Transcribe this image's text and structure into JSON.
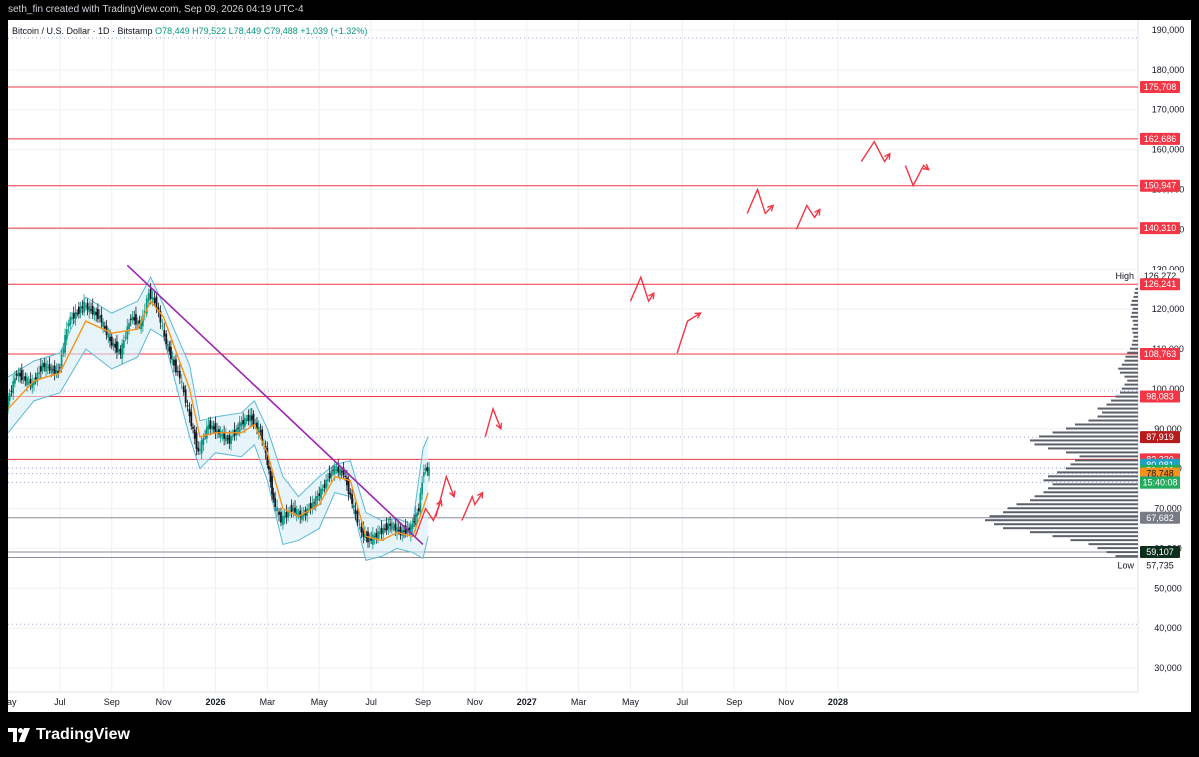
{
  "header": {
    "created_text": "seth_fin created with TradingView.com, Sep 09, 2026 04:19 UTC-4"
  },
  "legend": {
    "symbol": "Bitcoin / U.S. Dollar · 1D · Bitstamp",
    "open": "O78,449",
    "high": "H79,522",
    "low": "L78,449",
    "close": "C79,488",
    "change": "+1,039 (+1.32%)"
  },
  "footer": {
    "brand": "TradingView"
  },
  "colors": {
    "up": "#089981",
    "down": "#131722",
    "bb": "#5bb8d6",
    "bb_fill": "#d7eef6",
    "ma": "#f7931a",
    "trendline": "#9c27b0",
    "resistance": "#f23645",
    "grid": "#eef0f3",
    "axis_text": "#131722"
  },
  "chart_data": {
    "type": "line",
    "title": "Bitcoin / U.S. Dollar · 1D · Bitstamp",
    "y_axis": {
      "ticks": [
        30000,
        40000,
        50000,
        60000,
        70000,
        80000,
        90000,
        100000,
        110000,
        120000,
        130000,
        140000,
        150000,
        160000,
        170000,
        180000,
        190000
      ],
      "tick_labels": [
        "30,000",
        "40,000",
        "50,000",
        "60,000",
        "70,000",
        "80,000",
        "90,000",
        "100,000",
        "110,000",
        "120,000",
        "130,000",
        "140,000",
        "150,000",
        "160,000",
        "170,000",
        "180,000",
        "190,000"
      ],
      "range": [
        24000,
        192500
      ]
    },
    "x_axis": {
      "labels": [
        "May",
        "Jul",
        "Sep",
        "Nov",
        "2026",
        "Mar",
        "May",
        "Jul",
        "Sep",
        "Nov",
        "2027",
        "Mar",
        "May",
        "Jul",
        "Sep",
        "Nov",
        "2028"
      ],
      "bold": [
        false,
        false,
        false,
        false,
        true,
        false,
        false,
        false,
        false,
        false,
        true,
        false,
        false,
        false,
        false,
        false,
        true
      ],
      "index_range": [
        0,
        19
      ]
    },
    "price_path": [
      [
        0.0,
        96000
      ],
      [
        0.2,
        104000
      ],
      [
        0.5,
        101000
      ],
      [
        0.7,
        106000
      ],
      [
        1.0,
        104000
      ],
      [
        1.2,
        117000
      ],
      [
        1.5,
        121000
      ],
      [
        1.8,
        118000
      ],
      [
        2.0,
        112000
      ],
      [
        2.2,
        109000
      ],
      [
        2.4,
        118000
      ],
      [
        2.6,
        116000
      ],
      [
        2.75,
        124000
      ],
      [
        2.9,
        121000
      ],
      [
        3.05,
        113000
      ],
      [
        3.2,
        107000
      ],
      [
        3.35,
        103000
      ],
      [
        3.5,
        95000
      ],
      [
        3.7,
        84000
      ],
      [
        3.9,
        91000
      ],
      [
        4.1,
        89000
      ],
      [
        4.3,
        87000
      ],
      [
        4.5,
        91000
      ],
      [
        4.7,
        93000
      ],
      [
        4.9,
        89000
      ],
      [
        5.0,
        84000
      ],
      [
        5.15,
        72000
      ],
      [
        5.3,
        67000
      ],
      [
        5.5,
        70000
      ],
      [
        5.7,
        68000
      ],
      [
        5.9,
        71000
      ],
      [
        6.1,
        75000
      ],
      [
        6.3,
        80000
      ],
      [
        6.5,
        79000
      ],
      [
        6.7,
        70000
      ],
      [
        6.85,
        64000
      ],
      [
        7.0,
        62000
      ],
      [
        7.2,
        64000
      ],
      [
        7.4,
        66000
      ],
      [
        7.6,
        64000
      ],
      [
        7.8,
        65000
      ],
      [
        7.95,
        70000
      ],
      [
        8.05,
        80000
      ],
      [
        8.15,
        79488
      ]
    ],
    "bollinger": {
      "upper": [
        [
          0,
          103000
        ],
        [
          0.5,
          107000
        ],
        [
          1,
          109000
        ],
        [
          1.5,
          123000
        ],
        [
          2,
          119000
        ],
        [
          2.5,
          122000
        ],
        [
          2.75,
          128000
        ],
        [
          3,
          121000
        ],
        [
          3.5,
          106000
        ],
        [
          3.7,
          92000
        ],
        [
          4,
          93000
        ],
        [
          4.5,
          94000
        ],
        [
          4.75,
          97000
        ],
        [
          5,
          90000
        ],
        [
          5.3,
          78000
        ],
        [
          5.6,
          73000
        ],
        [
          6,
          78000
        ],
        [
          6.3,
          81000
        ],
        [
          6.6,
          82000
        ],
        [
          6.9,
          69000
        ],
        [
          7.2,
          67000
        ],
        [
          7.5,
          67500
        ],
        [
          7.8,
          66000
        ],
        [
          8.0,
          85000
        ],
        [
          8.1,
          88000
        ]
      ],
      "lower": [
        [
          0,
          89000
        ],
        [
          0.5,
          97000
        ],
        [
          1,
          99000
        ],
        [
          1.5,
          110000
        ],
        [
          2,
          105000
        ],
        [
          2.5,
          108000
        ],
        [
          2.75,
          115000
        ],
        [
          3,
          113000
        ],
        [
          3.5,
          88000
        ],
        [
          3.7,
          80000
        ],
        [
          4,
          84000
        ],
        [
          4.5,
          83000
        ],
        [
          4.75,
          86000
        ],
        [
          5,
          77000
        ],
        [
          5.3,
          61000
        ],
        [
          5.6,
          62000
        ],
        [
          6,
          65000
        ],
        [
          6.3,
          74000
        ],
        [
          6.6,
          73000
        ],
        [
          6.9,
          57000
        ],
        [
          7.2,
          58000
        ],
        [
          7.5,
          60000
        ],
        [
          7.8,
          59000
        ],
        [
          8.0,
          57500
        ],
        [
          8.1,
          63000
        ]
      ]
    },
    "moving_average": [
      [
        0,
        95000
      ],
      [
        0.5,
        102000
      ],
      [
        1,
        104000
      ],
      [
        1.5,
        117000
      ],
      [
        2,
        114000
      ],
      [
        2.5,
        115000
      ],
      [
        2.75,
        122000
      ],
      [
        3,
        118000
      ],
      [
        3.5,
        100000
      ],
      [
        3.7,
        88000
      ],
      [
        4,
        89000
      ],
      [
        4.5,
        89000
      ],
      [
        4.75,
        91000
      ],
      [
        5,
        84000
      ],
      [
        5.3,
        70000
      ],
      [
        5.6,
        68000
      ],
      [
        6,
        71000
      ],
      [
        6.3,
        78000
      ],
      [
        6.6,
        77000
      ],
      [
        6.9,
        63000
      ],
      [
        7.2,
        62000
      ],
      [
        7.5,
        64000
      ],
      [
        7.8,
        63000
      ],
      [
        8.0,
        70000
      ],
      [
        8.1,
        74000
      ]
    ],
    "trendline": [
      [
        2.3,
        131000
      ],
      [
        8.0,
        61000
      ]
    ],
    "resistance_levels": [
      175708,
      162686,
      150947,
      140310,
      126241,
      108763,
      98083,
      82320
    ],
    "gray_levels": [
      67682,
      57735,
      59107
    ],
    "dotted_levels": [
      188000,
      99500,
      87919,
      80200,
      78748,
      76577,
      41000
    ],
    "projection_zigzags": [
      [
        [
          7.85,
          63000
        ],
        [
          8.05,
          70000
        ],
        [
          8.2,
          67000
        ],
        [
          8.35,
          72000
        ]
      ],
      [
        [
          8.25,
          68000
        ],
        [
          8.45,
          78000
        ],
        [
          8.6,
          73000
        ]
      ],
      [
        [
          8.75,
          67000
        ],
        [
          8.95,
          73000
        ],
        [
          9.0,
          71000
        ],
        [
          9.15,
          74000
        ]
      ],
      [
        [
          9.2,
          88000
        ],
        [
          9.35,
          95000
        ],
        [
          9.5,
          90000
        ]
      ],
      [
        [
          12.0,
          122000
        ],
        [
          12.2,
          128000
        ],
        [
          12.35,
          122000
        ],
        [
          12.45,
          124000
        ]
      ],
      [
        [
          12.9,
          109000
        ],
        [
          13.1,
          117000
        ],
        [
          13.35,
          119000
        ]
      ],
      [
        [
          14.25,
          144000
        ],
        [
          14.45,
          150000
        ],
        [
          14.6,
          144000
        ],
        [
          14.75,
          146000
        ]
      ],
      [
        [
          15.2,
          140000
        ],
        [
          15.4,
          146000
        ],
        [
          15.55,
          143000
        ],
        [
          15.65,
          145000
        ]
      ],
      [
        [
          16.45,
          157000
        ],
        [
          16.7,
          162000
        ],
        [
          16.9,
          157000
        ],
        [
          17.0,
          159000
        ]
      ],
      [
        [
          17.3,
          156000
        ],
        [
          17.45,
          151000
        ],
        [
          17.65,
          156000
        ],
        [
          17.75,
          155000
        ]
      ]
    ],
    "volume_profile": [
      [
        58000,
        25
      ],
      [
        59000,
        35
      ],
      [
        60000,
        45
      ],
      [
        61000,
        55
      ],
      [
        62000,
        75
      ],
      [
        63000,
        95
      ],
      [
        64000,
        120
      ],
      [
        65000,
        150
      ],
      [
        66000,
        160
      ],
      [
        67000,
        170
      ],
      [
        68000,
        165
      ],
      [
        69000,
        150
      ],
      [
        70000,
        145
      ],
      [
        71000,
        135
      ],
      [
        72000,
        120
      ],
      [
        73000,
        115
      ],
      [
        74000,
        105
      ],
      [
        75000,
        100
      ],
      [
        76000,
        95
      ],
      [
        77000,
        105
      ],
      [
        78000,
        100
      ],
      [
        79000,
        90
      ],
      [
        80000,
        80
      ],
      [
        81000,
        75
      ],
      [
        82000,
        70
      ],
      [
        83000,
        65
      ],
      [
        84000,
        80
      ],
      [
        85000,
        100
      ],
      [
        86000,
        115
      ],
      [
        87000,
        120
      ],
      [
        88000,
        110
      ],
      [
        89000,
        95
      ],
      [
        90000,
        80
      ],
      [
        91000,
        70
      ],
      [
        92000,
        55
      ],
      [
        93000,
        45
      ],
      [
        94000,
        40
      ],
      [
        95000,
        45
      ],
      [
        96000,
        35
      ],
      [
        97000,
        30
      ],
      [
        98000,
        25
      ],
      [
        99000,
        20
      ],
      [
        100000,
        18
      ],
      [
        101000,
        15
      ],
      [
        102000,
        12
      ],
      [
        103000,
        15
      ],
      [
        104000,
        20
      ],
      [
        105000,
        22
      ],
      [
        106000,
        18
      ],
      [
        107000,
        15
      ],
      [
        108000,
        14
      ],
      [
        109000,
        12
      ],
      [
        110000,
        9
      ],
      [
        111000,
        7
      ],
      [
        112000,
        6
      ],
      [
        113000,
        5
      ],
      [
        114000,
        6
      ],
      [
        115000,
        7
      ],
      [
        116000,
        5
      ],
      [
        117000,
        6
      ],
      [
        118000,
        8
      ],
      [
        119000,
        7
      ],
      [
        120000,
        6
      ],
      [
        121000,
        8
      ],
      [
        122000,
        7
      ],
      [
        123000,
        5
      ],
      [
        124000,
        4
      ],
      [
        125000,
        3
      ]
    ],
    "price_tags": [
      {
        "value": 175708,
        "label": "175,708",
        "bg": "#f23645",
        "fg": "#ffffff"
      },
      {
        "value": 162686,
        "label": "162,686",
        "bg": "#f23645",
        "fg": "#ffffff"
      },
      {
        "value": 150947,
        "label": "150,947",
        "bg": "#f23645",
        "fg": "#ffffff"
      },
      {
        "value": 140310,
        "label": "140,310",
        "bg": "#f23645",
        "fg": "#ffffff"
      },
      {
        "value": 126272,
        "label": "126,272",
        "bg": "#ffffff",
        "fg": "#131722",
        "prefix": "High"
      },
      {
        "value": 126241,
        "label": "126,241",
        "bg": "#f23645",
        "fg": "#ffffff"
      },
      {
        "value": 108763,
        "label": "108,763",
        "bg": "#f23645",
        "fg": "#ffffff"
      },
      {
        "value": 98083,
        "label": "98,083",
        "bg": "#f23645",
        "fg": "#ffffff"
      },
      {
        "value": 87919,
        "label": "87,919",
        "bg": "#b71c1c",
        "fg": "#ffffff"
      },
      {
        "value": 82320,
        "label": "82,320",
        "bg": "#f23645",
        "fg": "#ffffff"
      },
      {
        "value": 80981,
        "label": "80,981",
        "bg": "#22a0c4",
        "fg": "#ffffff"
      },
      {
        "value": 79488,
        "label": "79,488",
        "bg": "#22ab5a",
        "fg": "#ffffff"
      },
      {
        "value": 78748,
        "label": "78,748",
        "bg": "#f7931a",
        "fg": "#131722"
      },
      {
        "value": 76577,
        "label": "76,577",
        "bg": "#22a0c4",
        "fg": "#ffffff"
      },
      {
        "value": 67682,
        "label": "67,682",
        "bg": "#787b86",
        "fg": "#ffffff"
      },
      {
        "value": 59107,
        "label": "59,107",
        "bg": "#0d2e1c",
        "fg": "#ffffff"
      },
      {
        "value": 57735,
        "label": "57,735",
        "bg": "#ffffff",
        "fg": "#131722",
        "prefix": "Low"
      }
    ],
    "countdown": "15:40:08",
    "last_price": 79488
  }
}
